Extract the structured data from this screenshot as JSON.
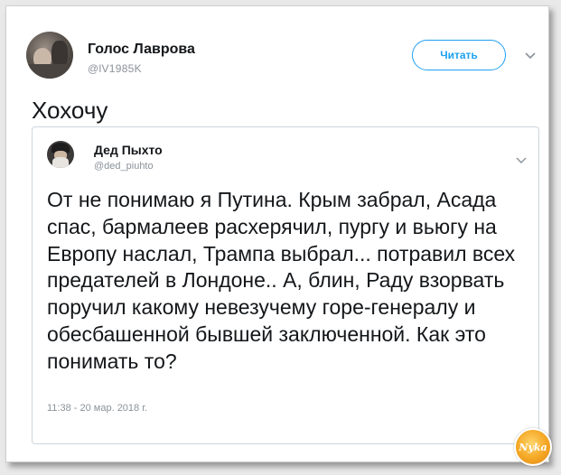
{
  "tweet": {
    "author": {
      "name": "Голос Лаврова",
      "handle": "@lV1985K"
    },
    "follow_label": "Читать",
    "text": "Хохочу",
    "quoted": {
      "author": {
        "name": "Дед Пыхто",
        "handle": "@ded_piuhto"
      },
      "body": "От не понимаю я Путина. Крым забрал, Асада спас, бармалеев расхерячил, пургу и вьюгу на Европу наслал, Трампа выбрал... потравил всех предателей в Лондоне.. А, блин, Раду взорвать поручил какому невезучему горе-генералу и обесбашенной бывшей заключенной. Как это понимать то?",
      "timestamp": "11:38 - 20 мар. 2018 г."
    }
  },
  "icons": {
    "menu_chevron": "chevron-down-icon"
  },
  "watermark": {
    "text": "Nyka"
  },
  "colors": {
    "accent": "#1da1f2",
    "text": "#14171a",
    "muted": "#8a9299",
    "border": "#ccd6dd"
  }
}
